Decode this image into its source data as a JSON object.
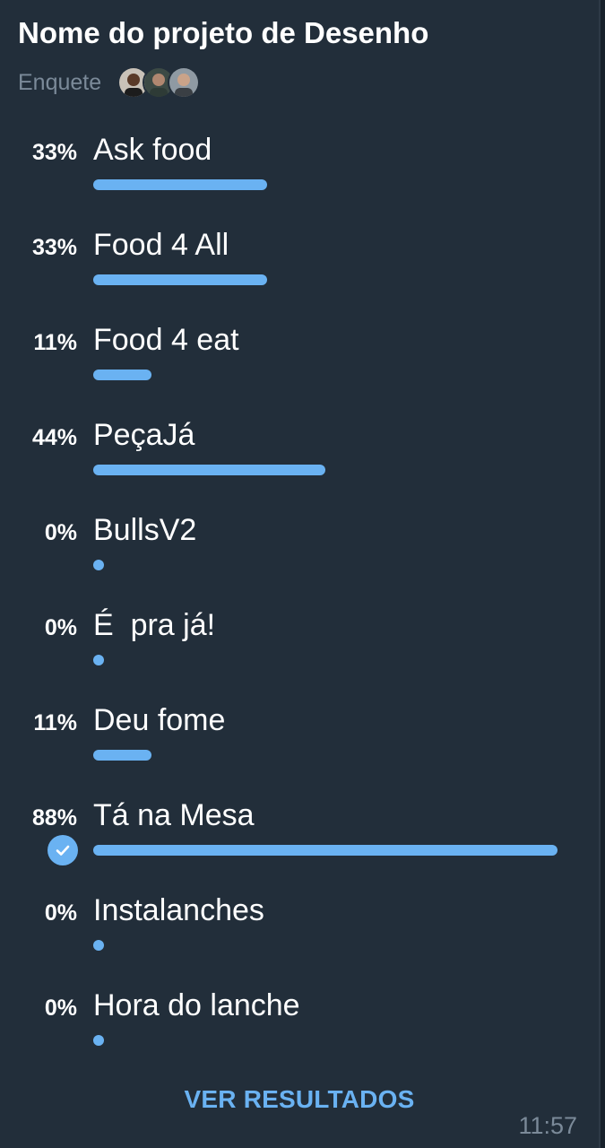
{
  "poll": {
    "title": "Nome do projeto de Desenho",
    "type_label": "Enquete",
    "voters": [
      "avatar-1",
      "avatar-2",
      "avatar-3"
    ],
    "options": [
      {
        "percent": "33%",
        "label": "Ask food",
        "fraction": 0.33,
        "chosen": false
      },
      {
        "percent": "33%",
        "label": "Food 4 All",
        "fraction": 0.33,
        "chosen": false
      },
      {
        "percent": "11%",
        "label": "Food 4 eat",
        "fraction": 0.11,
        "chosen": false
      },
      {
        "percent": "44%",
        "label": "PeçaJá",
        "fraction": 0.44,
        "chosen": false
      },
      {
        "percent": "0%",
        "label": "BullsV2",
        "fraction": 0,
        "chosen": false
      },
      {
        "percent": "0%",
        "label": "É  pra já!",
        "fraction": 0,
        "chosen": false
      },
      {
        "percent": "11%",
        "label": "Deu fome",
        "fraction": 0.11,
        "chosen": false
      },
      {
        "percent": "88%",
        "label": "Tá na Mesa",
        "fraction": 0.88,
        "chosen": true
      },
      {
        "percent": "0%",
        "label": "Instalanches",
        "fraction": 0,
        "chosen": false
      },
      {
        "percent": "0%",
        "label": "Hora do lanche",
        "fraction": 0,
        "chosen": false
      }
    ],
    "results_button": "VER RESULTADOS",
    "time": "11:57"
  },
  "colors": {
    "accent": "#6ab2f2",
    "background": "#222e3a",
    "muted": "#7b8a99"
  },
  "icons": {
    "check": "check-icon"
  }
}
